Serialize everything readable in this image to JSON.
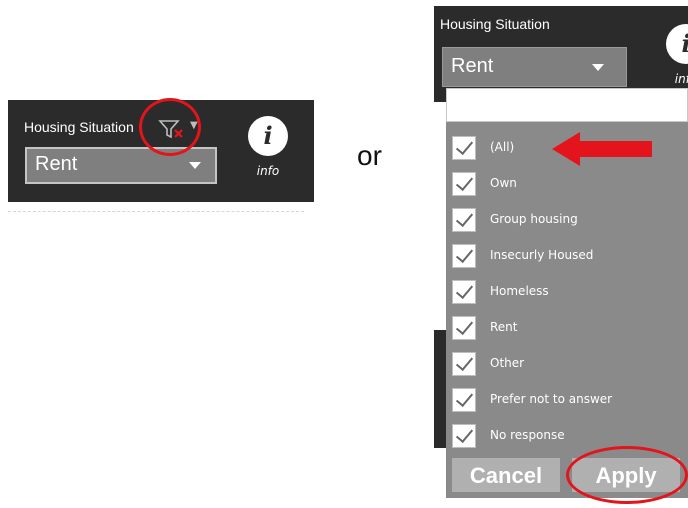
{
  "left_filter": {
    "title": "Housing Situation",
    "selected_value": "Rent",
    "info_glyph": "i",
    "info_label": "info",
    "icons": [
      "clear-filter-icon",
      "menu-caret-icon",
      "dropdown-caret-icon",
      "info-icon"
    ]
  },
  "separator_text": "or",
  "right_filter": {
    "title": "Housing Situation",
    "selected_value": "Rent",
    "info_glyph": "i",
    "info_label": "info",
    "search_placeholder": "",
    "options": [
      {
        "label": "(All)",
        "checked": true
      },
      {
        "label": "Own",
        "checked": true
      },
      {
        "label": "Group housing",
        "checked": true
      },
      {
        "label": "Insecurly Housed",
        "checked": true
      },
      {
        "label": "Homeless",
        "checked": true
      },
      {
        "label": "Rent",
        "checked": true
      },
      {
        "label": "Other",
        "checked": true
      },
      {
        "label": "Prefer not to answer",
        "checked": true
      },
      {
        "label": "No response",
        "checked": true
      }
    ],
    "cancel_label": "Cancel",
    "apply_label": "Apply"
  },
  "colors": {
    "panel_dark": "#2b2b2b",
    "dropdown_gray": "#7f7f7f",
    "list_gray": "#8a8a8a",
    "button_gray": "#b0b0b0",
    "annotation_red": "#e3141b"
  }
}
